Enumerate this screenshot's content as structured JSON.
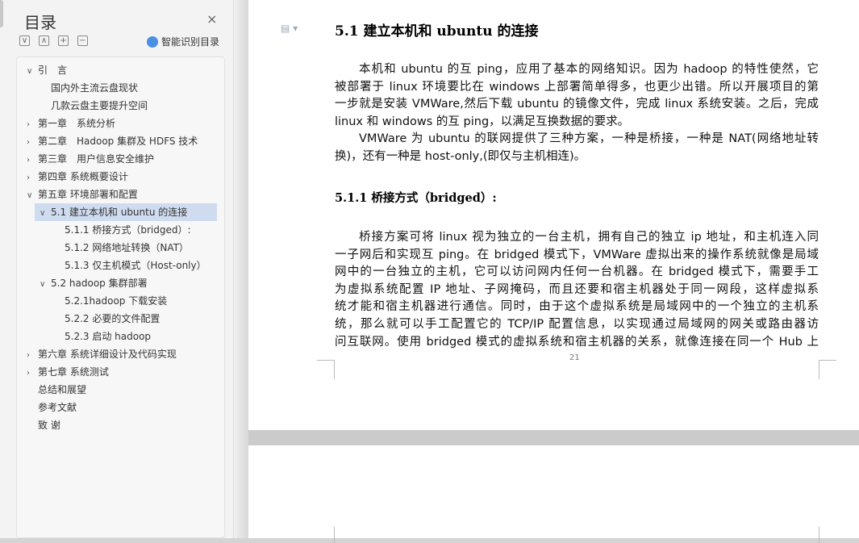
{
  "sidebar": {
    "title": "目录",
    "close": "×",
    "buttons": [
      "∨",
      "∧",
      "+",
      "−"
    ],
    "smart_label": "智能识别目录",
    "items": [
      {
        "label": "引　言",
        "level": 1,
        "arrow": "∨"
      },
      {
        "label": "国内外主流云盘现状",
        "level": 2,
        "arrow": ""
      },
      {
        "label": "几款云盘主要提升空间",
        "level": 2,
        "arrow": ""
      },
      {
        "label": "第一章　系统分析",
        "level": 1,
        "arrow": "›"
      },
      {
        "label": "第二章　Hadoop 集群及 HDFS 技术",
        "level": 1,
        "arrow": "›"
      },
      {
        "label": "第三章　用户信息安全维护",
        "level": 1,
        "arrow": "›"
      },
      {
        "label": "第四章 系统概要设计",
        "level": 1,
        "arrow": "›"
      },
      {
        "label": "第五章 环境部署和配置",
        "level": 1,
        "arrow": "∨"
      },
      {
        "label": "5.1  建立本机和 ubuntu 的连接",
        "level": 2,
        "arrow": "∨",
        "selected": true
      },
      {
        "label": "5.1.1  桥接方式（bridged）:",
        "level": 3,
        "arrow": ""
      },
      {
        "label": "5.1.2  网络地址转换（NAT）",
        "level": 3,
        "arrow": ""
      },
      {
        "label": "5.1.3  仅主机模式（Host-only）",
        "level": 3,
        "arrow": ""
      },
      {
        "label": "5.2 hadoop 集群部署",
        "level": 2,
        "arrow": "∨"
      },
      {
        "label": "5.2.1hadoop 下载安装",
        "level": 3,
        "arrow": ""
      },
      {
        "label": "5.2.2  必要的文件配置",
        "level": 3,
        "arrow": ""
      },
      {
        "label": "5.2.3  启动 hadoop",
        "level": 3,
        "arrow": ""
      },
      {
        "label": "第六章 系统详细设计及代码实现",
        "level": 1,
        "arrow": "›"
      },
      {
        "label": "第七章 系统测试",
        "level": 1,
        "arrow": "›"
      },
      {
        "label": "总结和展望",
        "level": 1,
        "arrow": ""
      },
      {
        "label": "参考文献",
        "level": 1,
        "arrow": ""
      },
      {
        "label": "致  谢",
        "level": 1,
        "arrow": ""
      }
    ]
  },
  "doc": {
    "heading": "5.1  建立本机和 ubuntu 的连接",
    "para1": [
      "本机和 ubuntu 的互 ping，应用了基本的网络知识。因为 hadoop 的特性使然，它",
      "被部署于 linux 环境要比在 windows 上部署简单得多，也更少出错。所以开展项目的第",
      "一步就是安装 VMWare,然后下载 ubuntu 的镜像文件，完成 linux 系统安装。之后，完成",
      "linux 和 windows 的互 ping，以满足互换数据的要求。"
    ],
    "para2": [
      "VMWare 为 ubuntu 的联网提供了三种方案，一种是桥接，一种是 NAT(网络地址转",
      "换)，还有一种是 host-only,(即仅与主机相连)。"
    ],
    "subheading": "5.1.1  桥接方式（bridged）:",
    "para3": [
      "桥接方案可将 linux 视为独立的一台主机，拥有自己的独立 ip 地址，和主机连入同",
      "一子网后和实现互 ping。在 bridged 模式下，VMWare 虚拟出来的操作系统就像是局域",
      "网中的一台独立的主机，它可以访问网内任何一台机器。在 bridged 模式下，需要手工",
      "为虚拟系统配置 IP 地址、子网掩码，而且还要和宿主机器处于同一网段，这样虚拟系",
      "统才能和宿主机器进行通信。同时，由于这个虚拟系统是局域网中的一个独立的主机系",
      "统，那么就可以手工配置它的 TCP/IP 配置信息，以实现通过局域网的网关或路由器访",
      "问互联网。使用 bridged 模式的虚拟系统和宿主机器的关系，就像连接在同一个 Hub 上"
    ],
    "page_number": "21"
  }
}
